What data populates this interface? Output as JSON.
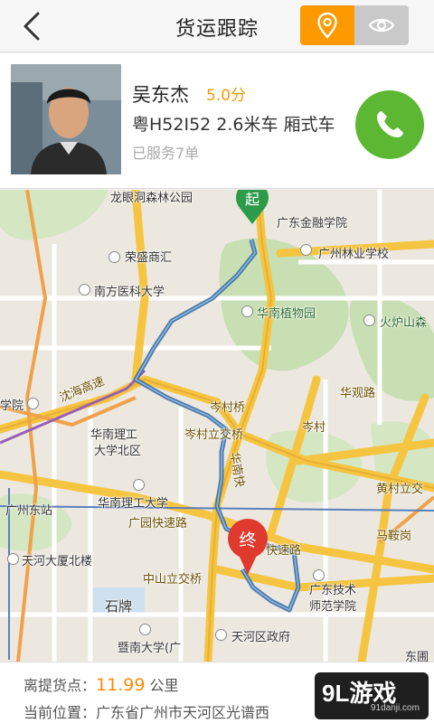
{
  "header": {
    "title": "货运跟踪",
    "back_icon": "chevron-left-icon",
    "mode_location_icon": "location-pin-icon",
    "mode_view_icon": "eye-icon"
  },
  "driver": {
    "name": "吴东杰",
    "rating": "5.0分",
    "vehicle": "粤H52I52 2.6米车 厢式车",
    "served": "已服务7单",
    "call_icon": "phone-icon"
  },
  "map": {
    "start_marker": "起",
    "end_marker": "终",
    "labels": {
      "longyan": "龙眼洞森林公园",
      "jinrong": "广东金融学院",
      "rongsheng": "荣盛商汇",
      "linye": "广州林业学校",
      "nanfang": "南方医科大学",
      "zhiwuyuan": "华南植物园",
      "huolushan": "火炉山森",
      "yanhai": "沈海高速",
      "xueyuan": "学院",
      "cencunqiao": "岑村桥",
      "huaguanlu": "华观路",
      "cencunlijiao": "岑村立交桥",
      "cencun": "岑村",
      "huanan_north": "华南理工",
      "huanan_north2": "大学北区",
      "huanankuai": "华南快",
      "huangcun": "黄村立交",
      "guangzhoudong": "广州东站",
      "huanan_ligong": "华南理工大学",
      "guangyuan": "广园快速路",
      "majiagang": "马鞍岗",
      "tianhe_dasha": "天河大厦北楼",
      "kuaisulu": "快速路",
      "zhongshan": "中山立交桥",
      "jishu": "广东技术",
      "shifan": "师范学院",
      "shipai": "石牌",
      "jinan": "暨南大学(广",
      "tianhe_gov": "天河区政府",
      "dongpu": "东圃"
    }
  },
  "footer": {
    "distance_label": "离提货点：",
    "distance_value": "11.99",
    "distance_unit": " 公里",
    "location_label": "当前位置：",
    "location_value": "广东省广州市天河区光谱西"
  },
  "watermark": {
    "logo": "9L游戏",
    "site": "91danji.com"
  },
  "colors": {
    "accent": "#ff9900",
    "call_green": "#5cb832",
    "start_green": "#2e9b4a",
    "end_red": "#e03a2e",
    "route": "#3a6ea5"
  }
}
